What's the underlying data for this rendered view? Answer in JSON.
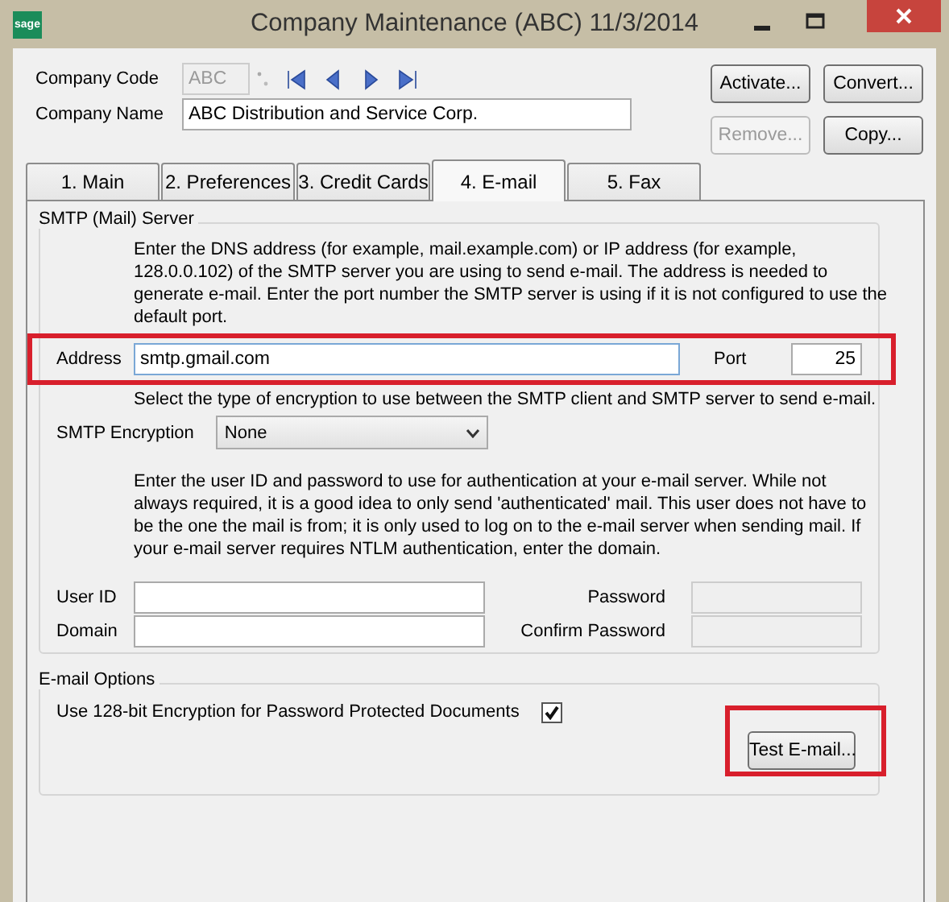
{
  "window": {
    "title": "Company Maintenance (ABC) 11/3/2014",
    "app_logo": "sage"
  },
  "header": {
    "company_code": {
      "label": "Company Code",
      "value": "ABC",
      "disabled": true
    },
    "company_name": {
      "label": "Company Name",
      "value": "ABC Distribution and Service Corp."
    },
    "buttons": [
      {
        "label": "Activate...",
        "disabled": false
      },
      {
        "label": "Convert...",
        "disabled": false
      },
      {
        "label": "Remove...",
        "disabled": true
      },
      {
        "label": "Copy...",
        "disabled": false
      }
    ]
  },
  "tabs": [
    {
      "label": "1. Main",
      "selected": false
    },
    {
      "label": "2. Preferences",
      "selected": false
    },
    {
      "label": "3. Credit Cards",
      "selected": false
    },
    {
      "label": "4. E-mail",
      "selected": true
    },
    {
      "label": "5. Fax",
      "selected": false
    }
  ],
  "smtp_server": {
    "title": "SMTP (Mail) Server",
    "intro": "Enter the DNS address (for example, mail.example.com) or IP address (for example, 128.0.0.102) of the SMTP server you are using to send e-mail. The address is needed to generate e-mail. Enter the port number the SMTP server is using if it is not configured to use the default port.",
    "address": {
      "label": "Address",
      "value": "smtp.gmail.com",
      "highlighted": true
    },
    "port": {
      "label": "Port",
      "value": "25"
    },
    "encryption_note": "Select the type of encryption to use between the SMTP client and SMTP server to send e-mail.",
    "encryption": {
      "label": "SMTP Encryption",
      "value": "None"
    },
    "auth_note": "Enter the user ID and password to use for authentication at your e-mail server.  While not always required, it is a good idea to only send 'authenticated' mail.  This user does not have to be the one the mail is from; it is only used to log on to the e-mail server when sending mail.  If your e-mail server requires NTLM authentication, enter the domain.",
    "user_id": {
      "label": "User ID"
    },
    "domain": {
      "label": "Domain"
    },
    "password": {
      "label": "Password",
      "disabled": true
    },
    "confirm_password": {
      "label": "Confirm Password",
      "disabled": true
    }
  },
  "email_options": {
    "title": "E-mail Options",
    "encryption_option": {
      "label": "Use 128-bit Encryption for Password Protected Documents",
      "checked": true
    },
    "test_button": {
      "label": "Test E-mail...",
      "highlighted": true
    }
  }
}
